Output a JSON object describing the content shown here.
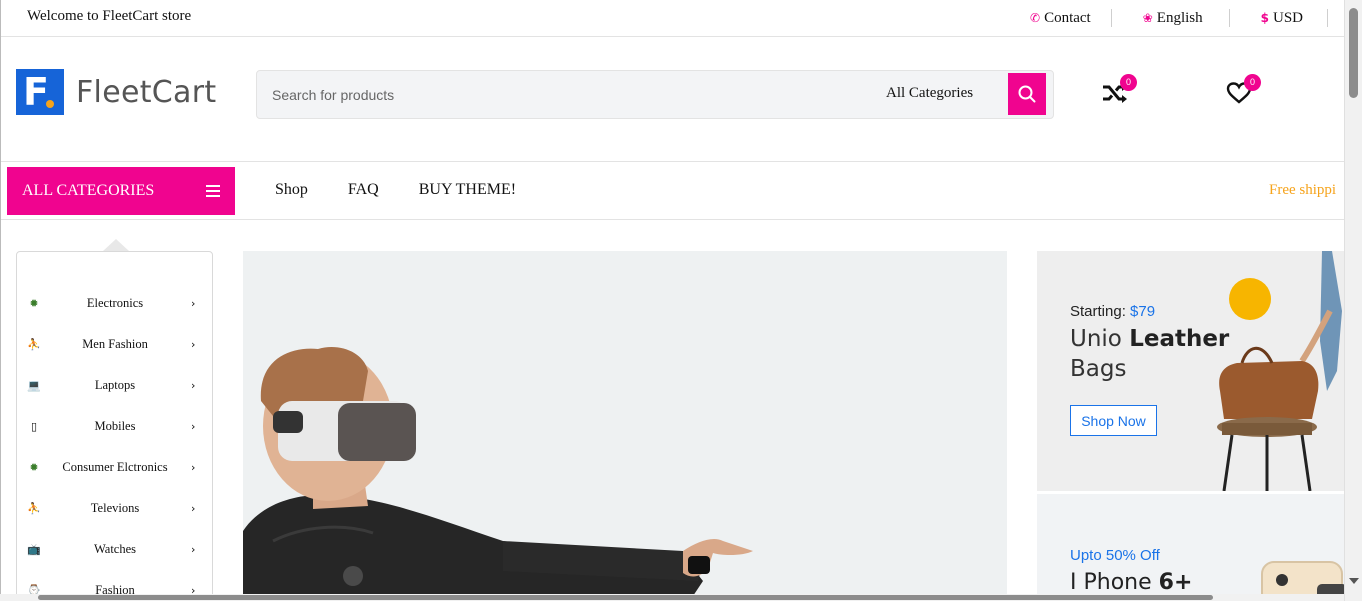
{
  "topbar": {
    "welcome": "Welcome to FleetCart store",
    "contact": "Contact",
    "language": "English",
    "currency": "USD"
  },
  "header": {
    "logo_letter": "F",
    "logo_text": "FleetCart",
    "search_placeholder": "Search for products",
    "category_select": "All Categories",
    "compare_count": "0",
    "wishlist_count": "0"
  },
  "nav": {
    "all_categories": "ALL CATEGORIES",
    "menu": [
      "Shop",
      "FAQ",
      "BUY THEME!"
    ],
    "promo": "Free shippi"
  },
  "sidebar": {
    "items": [
      {
        "label": "Electronics",
        "icon": "chip-icon"
      },
      {
        "label": "Men Fashion",
        "icon": "tshirt-icon"
      },
      {
        "label": "Laptops",
        "icon": "laptop-icon"
      },
      {
        "label": "Mobiles",
        "icon": "mobile-icon"
      },
      {
        "label": "Consumer Elctronics",
        "icon": "chip-icon"
      },
      {
        "label": "Televions",
        "icon": "tshirt-icon"
      },
      {
        "label": "Watches",
        "icon": "tv-icon"
      },
      {
        "label": "Fashion",
        "icon": "watch-icon"
      }
    ]
  },
  "banners": {
    "b1_starting": "Starting:",
    "b1_price": "$79",
    "b1_title_light": "Unio",
    "b1_title_bold": "Leather",
    "b1_title_line2": "Bags",
    "b1_button": "Shop Now",
    "b2_offer": "Upto 50% Off",
    "b2_title_light": "I Phone",
    "b2_title_bold": "6+"
  },
  "colors": {
    "accent": "#f0048f",
    "brand_blue": "#1664d8",
    "link_blue": "#1a73e8",
    "promo_orange": "#f6a31b"
  }
}
